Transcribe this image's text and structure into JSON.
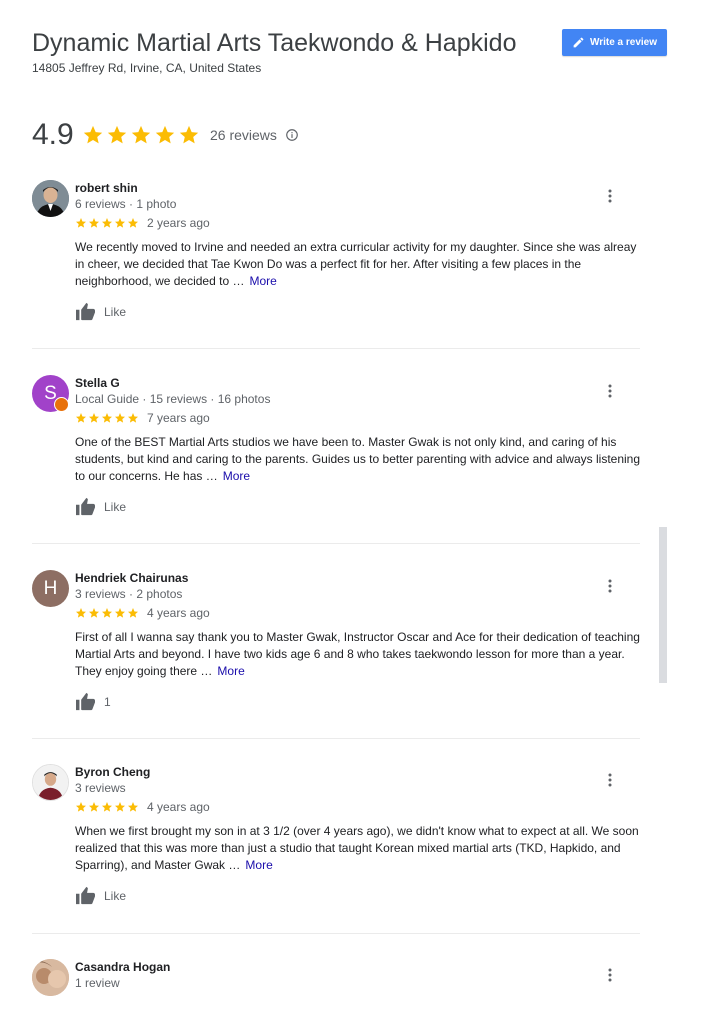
{
  "place": {
    "name": "Dynamic Martial Arts Taekwondo & Hapkido",
    "address": "14805 Jeffrey Rd, Irvine, CA, United States",
    "rating": "4.9",
    "stars": 5,
    "review_count_label": "26 reviews"
  },
  "write_review": {
    "label": "Write a review",
    "icon": "pencil-icon"
  },
  "colors": {
    "star": "#fbbc04",
    "accent": "#4285f4",
    "link": "#1a0dab"
  },
  "reviews": [
    {
      "name": "robert shin",
      "meta": "6 reviews · 1 photo",
      "stars": 5,
      "date": "2 years ago",
      "text": "We recently moved to Irvine and needed an extra curricular activity for my daughter.  Since she was alreay in cheer, we decided that Tae Kwon Do was a perfect fit for her.  After visiting a few places in the neighborhood, we decided to …",
      "more": "More",
      "like": "Like",
      "avatar": "photo"
    },
    {
      "name": "Stella G",
      "meta": "Local Guide · 15 reviews · 16 photos",
      "stars": 5,
      "date": "7 years ago",
      "text": "One of the BEST Martial Arts studios we have been to. Master Gwak is not only kind, and caring of his students, but kind and caring to the parents. Guides us to better parenting with advice and always listening to our concerns. He has …",
      "more": "More",
      "like": "Like",
      "avatar": "letter",
      "avatar_letter": "S",
      "avatar_color": "#a142c9"
    },
    {
      "name": "Hendriek Chairunas",
      "meta": "3 reviews · 2 photos",
      "stars": 5,
      "date": "4 years ago",
      "text": "First of all I wanna say thank you to Master Gwak, Instructor Oscar and Ace for their dedication of teaching Martial Arts and beyond. I have two kids age 6 and 8 who takes taekwondo lesson for more than a year.  They enjoy going there …",
      "more": "More",
      "like": "1",
      "avatar": "letter",
      "avatar_letter": "H",
      "avatar_color": "#8d6e63"
    },
    {
      "name": "Byron Cheng",
      "meta": "3 reviews",
      "stars": 5,
      "date": "4 years ago",
      "text": "When we first brought my son in at 3 1/2 (over 4 years ago), we didn't know what to expect at all. We soon realized that this was more than just a studio that taught Korean mixed martial arts (TKD, Hapkido, and Sparring), and Master Gwak …",
      "more": "More",
      "like": "Like",
      "avatar": "photo"
    },
    {
      "name": "Casandra Hogan",
      "meta": "1 review",
      "avatar": "photo"
    }
  ]
}
